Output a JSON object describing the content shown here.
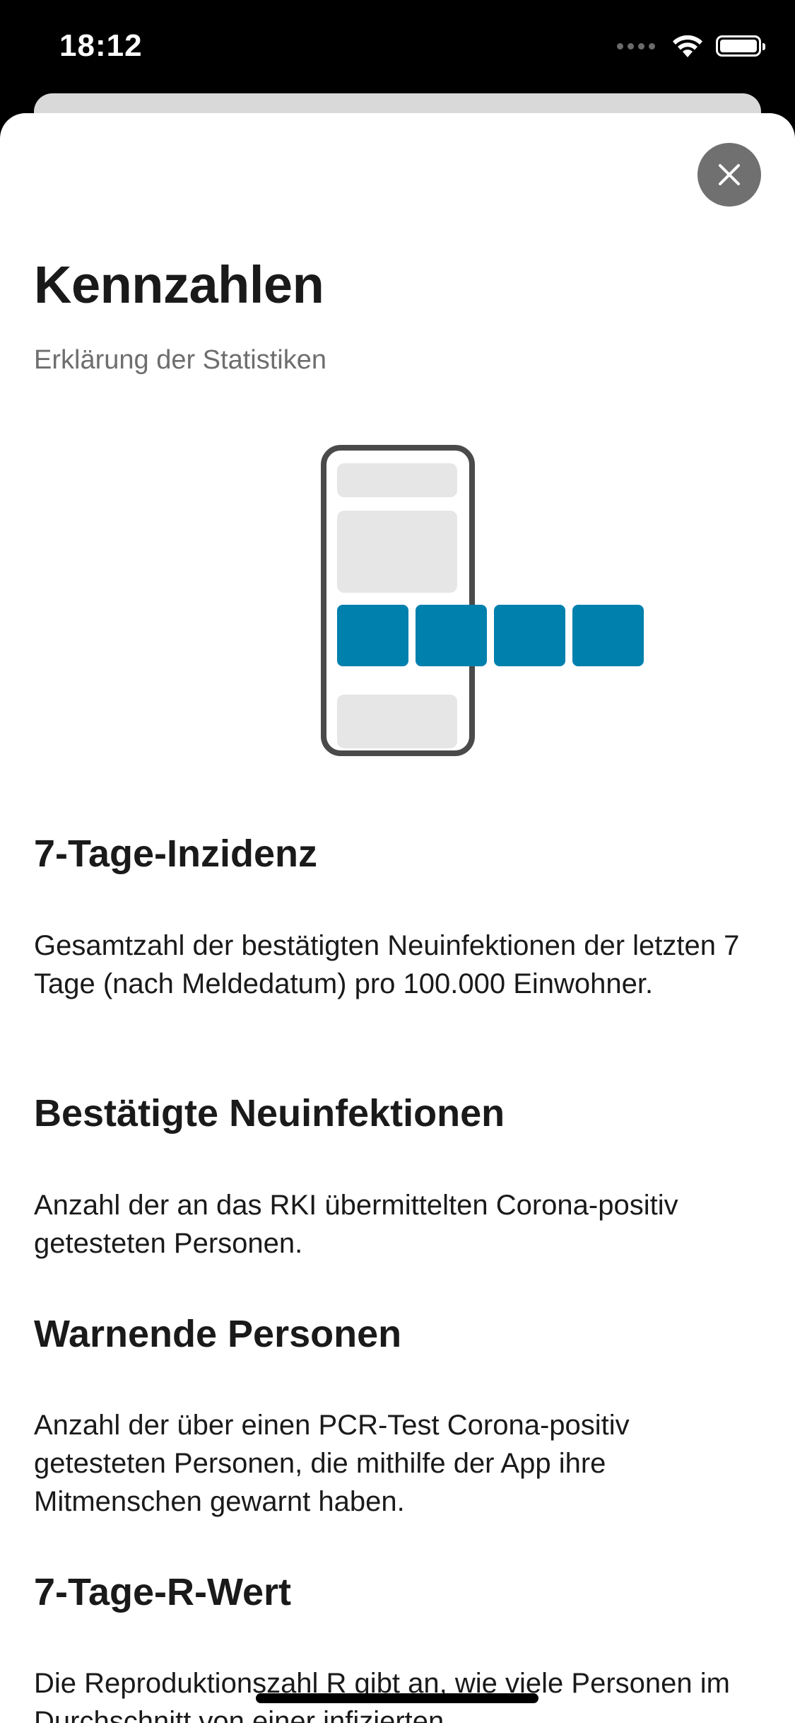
{
  "status_bar": {
    "time": "18:12",
    "icons": [
      "cellular-signal-icon",
      "wifi-icon",
      "battery-icon"
    ]
  },
  "sheet": {
    "close_icon": "close-icon",
    "title": "Kennzahlen",
    "subtitle": "Erklärung der Statistiken",
    "illustration": "phone-with-horizontal-cards-illustration",
    "sections": [
      {
        "heading": "7-Tage-Inzidenz",
        "text": "Gesamtzahl der bestätigten Neuinfektionen der letzten 7 Tage (nach Meldedatum) pro 100.000 Einwohner."
      },
      {
        "heading": "Bestätigte Neuinfektionen",
        "text": "Anzahl der an das RKI übermittelten Corona-positiv getesteten Personen."
      },
      {
        "heading": "Warnende Personen",
        "text": "Anzahl der über einen PCR-Test Corona-positiv getesteten Personen, die mithilfe der App ihre Mitmenschen gewarnt haben."
      },
      {
        "heading": "7-Tage-R-Wert",
        "text": "Die Reproduktionszahl R gibt an, wie viele Personen im Durchschnitt von einer infizierten"
      }
    ]
  },
  "colors": {
    "accent": "#0080ad",
    "placeholder": "#e6e6e6",
    "close_button": "#707070",
    "text": "#1a1a1a",
    "subtitle": "#6e6e6e"
  }
}
